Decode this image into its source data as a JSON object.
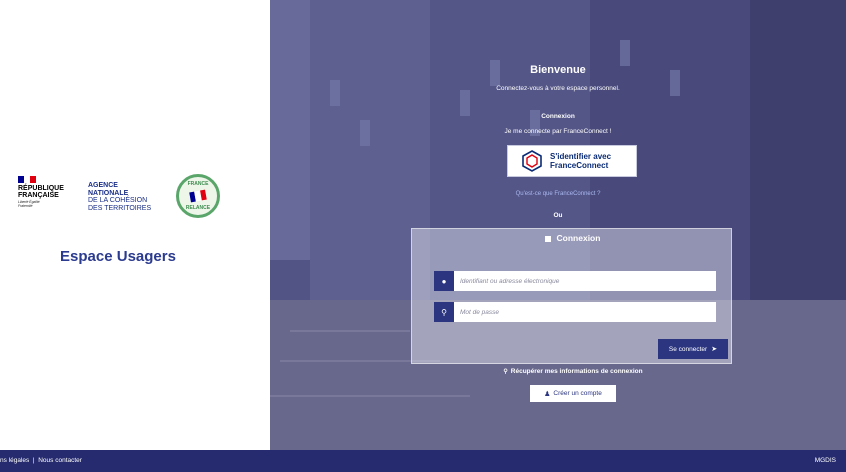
{
  "left": {
    "rf": {
      "name_line1": "RÉPUBLIQUE",
      "name_line2": "FRANÇAISE",
      "motto": "Liberté Égalité Fraternité",
      "flag_colors": [
        "#000091",
        "#ffffff",
        "#e1000f"
      ]
    },
    "anct": {
      "line1": "AGENCE",
      "line2": "NATIONALE",
      "line3": "DE LA COHÉSION",
      "line4": "DES TERRITOIRES"
    },
    "seal": {
      "top_text": "FRANCE",
      "bottom_text": "RELANCE"
    },
    "title": "Espace Usagers"
  },
  "main": {
    "welcome": "Bienvenue",
    "welcome_sub": "Connectez-vous à votre espace personnel.",
    "connexion_label": "Connexion",
    "franceconnect_intro": "Je me connecte par FranceConnect !",
    "franceconnect_button_line1": "S'identifier avec",
    "franceconnect_button_line2": "FranceConnect",
    "franceconnect_link": "Qu'est-ce que FranceConnect ?",
    "or": "Ou",
    "login": {
      "title": "Connexion",
      "identifier_placeholder": "Identifiant ou adresse électronique",
      "password_placeholder": "Mot de passe",
      "submit_label": "Se connecter"
    },
    "recover_label": "Récupérer mes informations de connexion",
    "create_account_label": "Créer un compte"
  },
  "footer": {
    "legal": "ns légales",
    "separator": "|",
    "contact": "Nous contacter",
    "right": "MGDIS"
  },
  "colors": {
    "primary": "#2b3580",
    "footer_bg": "#252b6e",
    "title_blue": "#2b3b8f"
  },
  "icons": {
    "user": "user-icon",
    "key": "key-icon",
    "signin": "sign-in-arrow-icon",
    "add_user": "add-user-icon"
  }
}
